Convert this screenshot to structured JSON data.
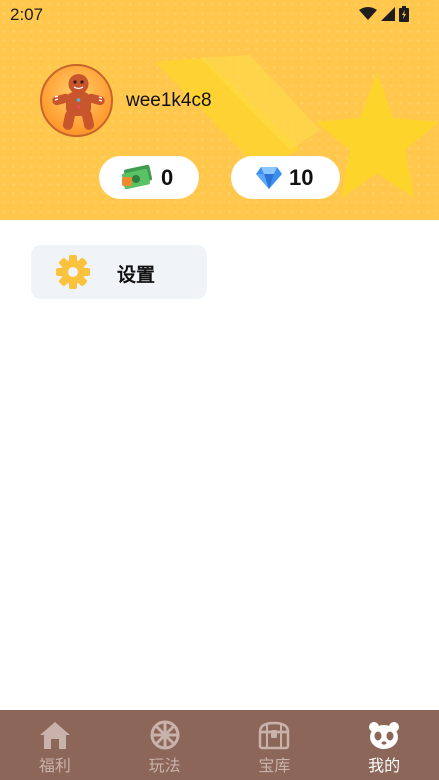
{
  "status_bar": {
    "time": "2:07",
    "icons": [
      "wifi-icon",
      "signal-icon",
      "battery-icon"
    ]
  },
  "profile": {
    "username": "wee1k4c8",
    "avatar_icon": "gingerbread-man-avatar"
  },
  "currency": {
    "cash": {
      "icon": "cash-icon",
      "value": "0"
    },
    "gems": {
      "icon": "diamond-icon",
      "value": "10"
    }
  },
  "settings": {
    "label": "设置",
    "icon": "gear-icon"
  },
  "bottom_nav": {
    "items": [
      {
        "label": "福利",
        "icon": "home-icon"
      },
      {
        "label": "玩法",
        "icon": "wheel-icon"
      },
      {
        "label": "宝库",
        "icon": "treasure-chest-icon"
      },
      {
        "label": "我的",
        "icon": "panda-icon"
      }
    ],
    "active_index": 3
  },
  "colors": {
    "header_bg": "#ffc84d",
    "star": "#fdd52a",
    "nav_bg": "#8b6659",
    "nav_inactive": "#c9b2aa",
    "nav_active": "#ffffff",
    "settings_bg": "#f0f3f8"
  }
}
